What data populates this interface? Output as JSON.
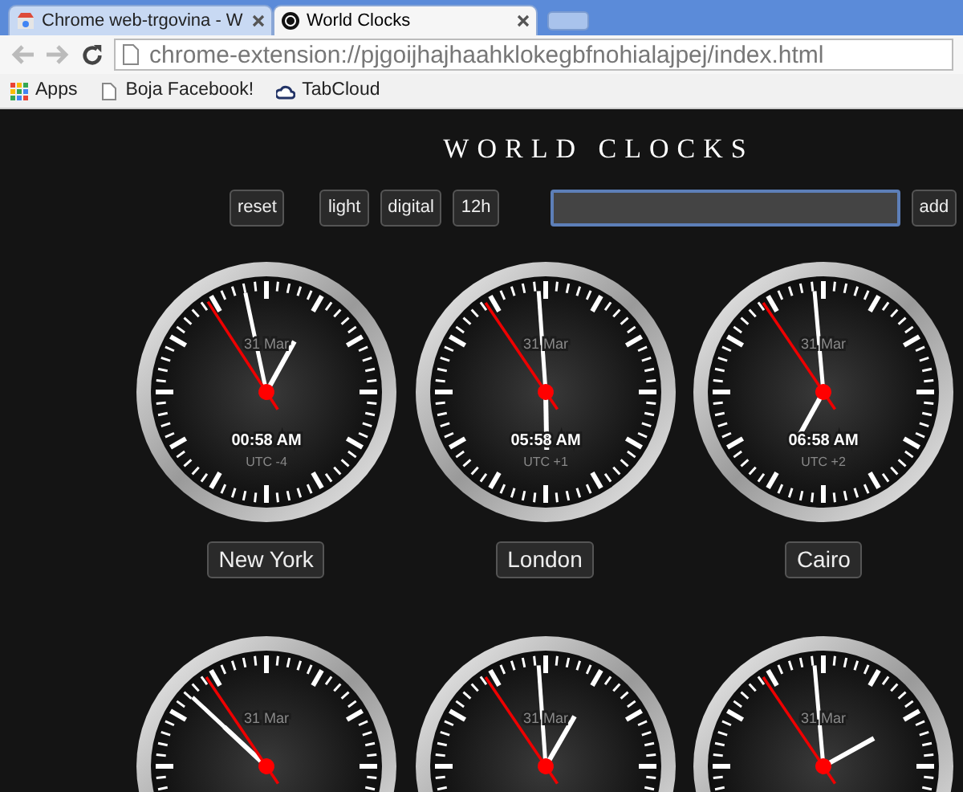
{
  "browser": {
    "tabs": [
      {
        "title": "Chrome web-trgovina - W",
        "selected": false
      },
      {
        "title": "World Clocks",
        "selected": true
      }
    ],
    "address": "chrome-extension://pjgoijhajhaahklokegbfnohialajpej/index.html",
    "bookmarks": [
      {
        "label": "Apps",
        "kind": "apps"
      },
      {
        "label": "Boja Facebook!",
        "kind": "page"
      },
      {
        "label": "TabCloud",
        "kind": "cloud"
      }
    ]
  },
  "page": {
    "title": "WORLD CLOCKS",
    "buttons": [
      "reset",
      "light",
      "digital",
      "12h"
    ],
    "add_button": "add"
  },
  "clocks": [
    {
      "date": "31 Mar",
      "time": "00:58 AM",
      "offset": "UTC -4",
      "city": "New York"
    },
    {
      "date": "31 Mar",
      "time": "05:58 AM",
      "offset": "UTC +1",
      "city": "London"
    },
    {
      "date": "31 Mar",
      "time": "06:58 AM",
      "offset": "UTC +2",
      "city": "Cairo"
    },
    {
      "date": "31 Mar"
    },
    {
      "date": "31 Mar"
    },
    {
      "date": "31 Mar"
    }
  ]
}
